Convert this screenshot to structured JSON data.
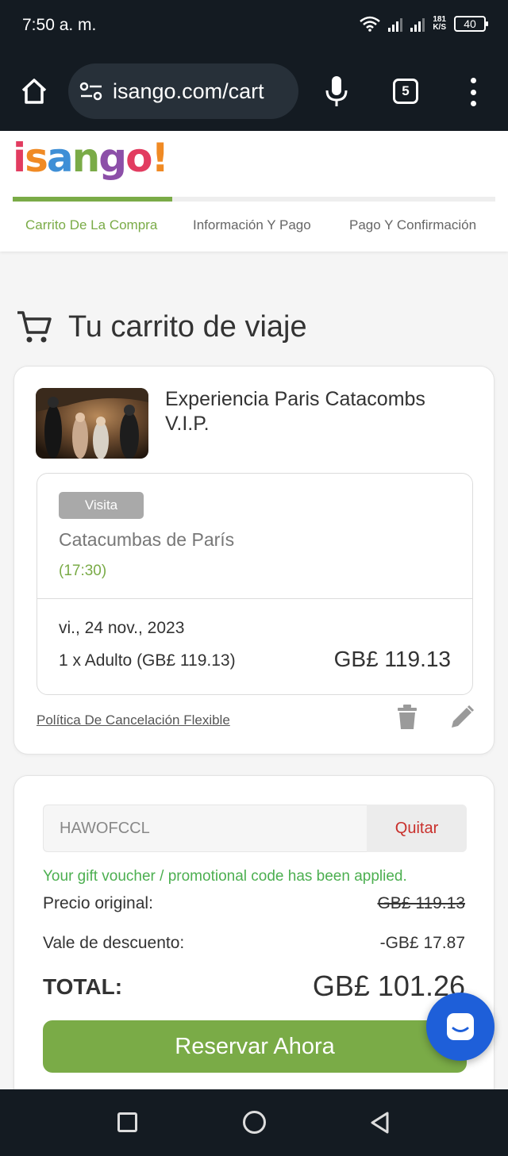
{
  "status_bar": {
    "time": "7:50 a. m.",
    "speed_value": "181",
    "speed_unit": "K/S",
    "battery": "40"
  },
  "browser": {
    "url": "isango.com/cart",
    "tab_count": "5"
  },
  "site": {
    "logo_text": "isango!",
    "logo_colors": [
      "#e23c60",
      "#f08a24",
      "#3f8fd6",
      "#7aab47",
      "#8c4fa8"
    ],
    "checkout_progress": 0.33,
    "steps": [
      "Carrito De La Compra",
      "Información Y Pago",
      "Pago Y Confirmación"
    ],
    "active_step_color": "#7aab47"
  },
  "cart": {
    "heading": "Tu carrito de viaje",
    "item": {
      "title": "Experiencia Paris Catacombs V.I.P.",
      "badge": "Visita",
      "venue": "Catacumbas de París",
      "time": "(17:30)",
      "date": "vi., 24 nov., 2023",
      "quantity_line": "1 x Adulto (GB£ 119.13)",
      "price": "GB£ 119.13",
      "cancellation_policy": "Política De Cancelación Flexible"
    },
    "promo": {
      "code": "HAWOFCCL",
      "remove_label": "Quitar",
      "applied_message": "Your gift voucher / promotional code has been applied."
    },
    "summary": {
      "original_label": "Precio original:",
      "original_value": "GB£ 119.13",
      "discount_label": "Vale de descuento:",
      "discount_value": "-GB£ 17.87",
      "total_label": "TOTAL:",
      "total_value": "GB£ 101.26"
    },
    "book_label": "Reservar Ahora"
  },
  "colors": {
    "accent_green": "#7aab47",
    "success_green": "#4caf50",
    "remove_red": "#c9302c",
    "chat_blue": "#1e5fd9"
  },
  "icons": [
    "home-icon",
    "site-settings-icon",
    "mic-icon",
    "tab-switcher-icon",
    "more-vert-icon",
    "cart-icon",
    "trash-icon",
    "edit-icon",
    "chat-icon",
    "recent-apps-icon",
    "home-circle-icon",
    "back-icon"
  ]
}
